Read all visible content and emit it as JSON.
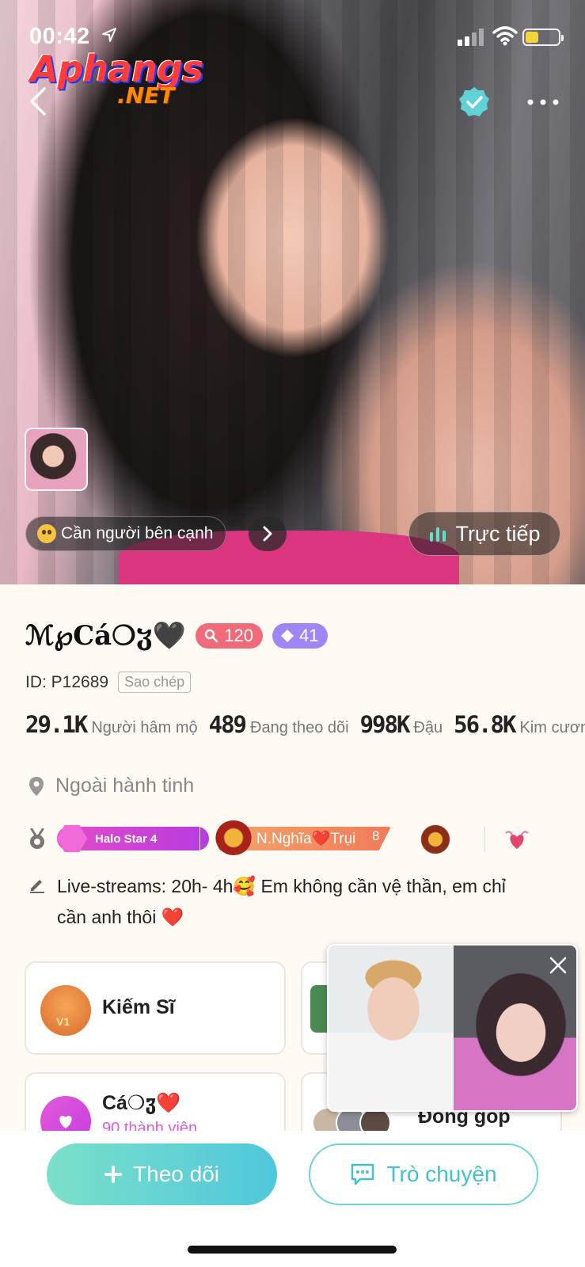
{
  "status_bar": {
    "time": "00:42"
  },
  "watermark": {
    "main": "Aphangs",
    "sub": ".NET"
  },
  "hero": {
    "mood_text": "Cần người bên cạnh",
    "live_label": "Trực tiếp"
  },
  "profile": {
    "name": "ℳ℘Cá❍ჳ🖤",
    "level": "120",
    "diamond_level": "41",
    "id_text": "ID: P12689",
    "copy_label": "Sao chép",
    "stats": [
      {
        "value": "29.1K",
        "label": "Người hâm mộ"
      },
      {
        "value": "489",
        "label": "Đang theo dõi"
      },
      {
        "value": "998K",
        "label": "Đậu"
      },
      {
        "value": "56.8K",
        "label": "Kim cương"
      }
    ],
    "location": "Ngoài hành tinh",
    "badges": {
      "halo_star": "Halo Star 4",
      "fan_club": "N.Nghĩa❤️Trụi",
      "fan_level": "8"
    },
    "bio_line1": "Live-streams: 20h- 4h🥰  Em không cần vệ thần, em chỉ",
    "bio_line2": "cần anh thôi ❤️"
  },
  "cards": {
    "rank_title": "Kiếm Sĩ",
    "club_name": "Cá❍ჳ❤️",
    "club_sub": "90 thành viên",
    "contrib_title": "Đóng góp"
  },
  "actions": {
    "follow_label": "Theo dõi",
    "chat_label": "Trò chuyện"
  },
  "colors": {
    "accent_teal": "#4fc7dc",
    "level_badge": "#f06a7a",
    "diamond_badge": "#9e86f5",
    "halo_badge": "#e44bc8",
    "verified": "#5fd3d8"
  }
}
